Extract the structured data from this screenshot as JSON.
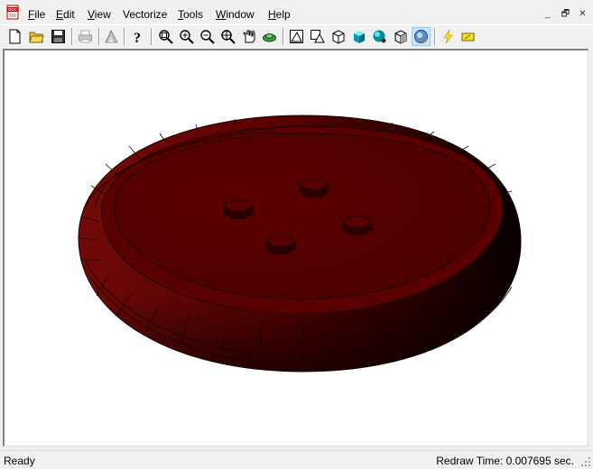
{
  "app": {
    "icon": "doc-app-icon"
  },
  "menu": [
    {
      "id": "file",
      "underline": "F",
      "rest": "ile"
    },
    {
      "id": "edit",
      "underline": "E",
      "rest": "dit"
    },
    {
      "id": "view",
      "underline": "V",
      "rest": "iew"
    },
    {
      "id": "vectorize",
      "underline": "",
      "rest": "Vectorize"
    },
    {
      "id": "tools",
      "underline": "T",
      "rest": "ools"
    },
    {
      "id": "window",
      "underline": "W",
      "rest": "indow"
    },
    {
      "id": "help",
      "underline": "H",
      "rest": "elp"
    }
  ],
  "window_controls": {
    "minimize": "_",
    "restore": "🗗",
    "close": "✕"
  },
  "toolbar_icons": [
    "new-file-icon",
    "open-folder-icon",
    "save-icon",
    "print-icon",
    "measure-icon",
    "help-icon",
    "zoom-extents-icon",
    "zoom-in-icon",
    "zoom-out-icon",
    "zoom-window-icon",
    "pan-icon",
    "orbit-icon",
    "wireframe-icon",
    "hidden-line-icon",
    "box-icon",
    "shaded-box-icon",
    "shaded-sphere-icon",
    "box-outline-icon",
    "render-mode-icon",
    "lightning-icon",
    "highlight-icon"
  ],
  "status": {
    "left": "Ready",
    "right": "Redraw Time: 0.007695 sec."
  },
  "model": {
    "fill_color": "#5a0000",
    "rim_color": "#6a0a0a",
    "edge_color": "#1a0000"
  }
}
